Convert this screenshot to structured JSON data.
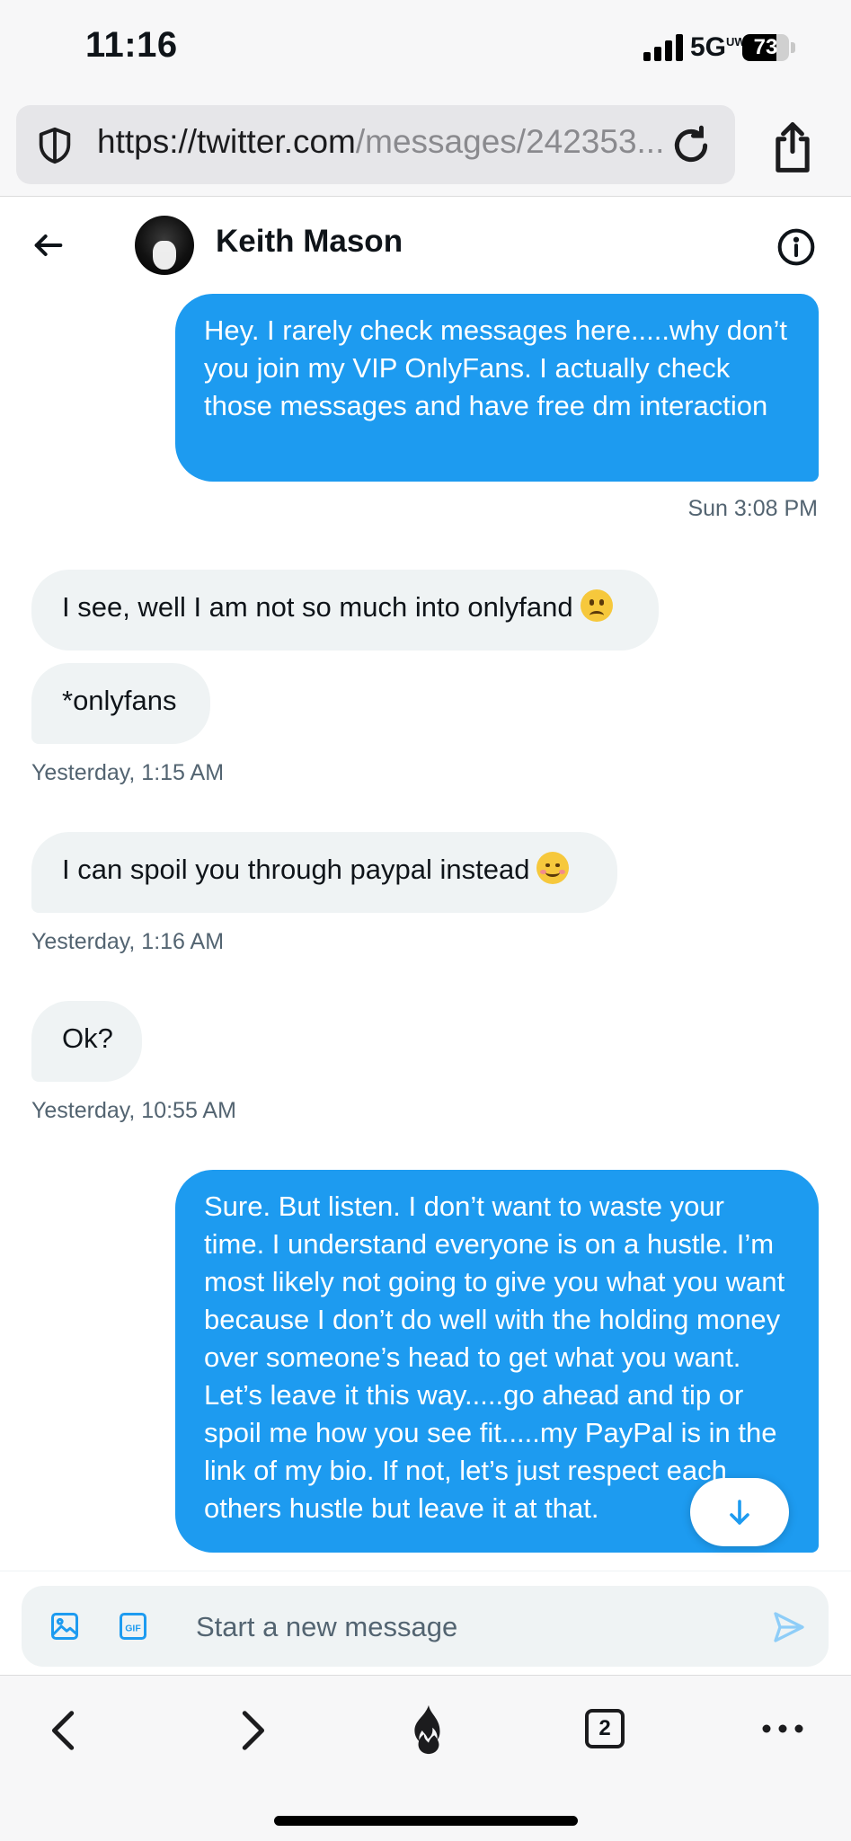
{
  "status_bar": {
    "time": "11:16",
    "network": "5G",
    "network_suffix": "UW",
    "battery": "73",
    "battery_level": 0.73
  },
  "browser": {
    "url_host": "https://twitter.com",
    "url_path": "/messages/242353..."
  },
  "conversation": {
    "contact_name": "Keith Mason",
    "messages": [
      {
        "direction": "sent",
        "text": "Hey.  I rarely check messages here.....why don’t you join my VIP OnlyFans.   I actually check those messages and have free dm interaction",
        "timestamp": "Sun 3:08 PM"
      },
      {
        "direction": "received",
        "text": "I see, well I am not so much into onlyfand",
        "emoji": "slightly-frowning-face"
      },
      {
        "direction": "received",
        "text": "*onlyfans",
        "timestamp": "Yesterday, 1:15 AM"
      },
      {
        "direction": "received",
        "text": "I can spoil you through paypal instead",
        "emoji": "smiling-face-with-smiling-eyes",
        "timestamp": "Yesterday, 1:16 AM"
      },
      {
        "direction": "received",
        "text": "Ok?",
        "timestamp": "Yesterday, 10:55 AM"
      },
      {
        "direction": "sent",
        "text": "Sure.  But listen.  I don’t want to waste your time.  I understand everyone is on a hustle.  I’m most likely not going to give you what you want because I don’t do well with the holding money over someone’s head to get what you want.  Let’s leave it this way.....go ahead and tip or spoil me how you see fit.....my PayPal is in the link of my bio.  If not, let’s just respect each others hustle but leave it at that."
      }
    ]
  },
  "composer": {
    "placeholder": "Start a new message"
  },
  "toolbar": {
    "tab_count": "2"
  },
  "colors": {
    "accent": "#1d9bf0",
    "received_bubble": "#eff3f4",
    "timestamp": "#536471"
  }
}
